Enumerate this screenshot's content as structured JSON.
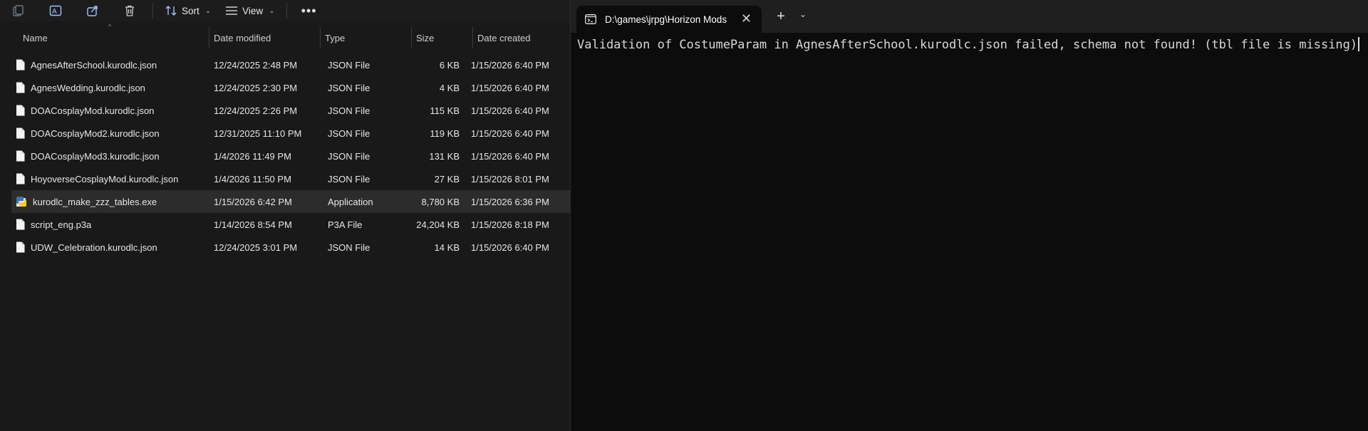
{
  "explorer": {
    "toolbar": {
      "sort_label": "Sort",
      "view_label": "View",
      "more_label": "•••",
      "icons": [
        "copy-icon",
        "rename-icon",
        "share-icon",
        "delete-icon",
        "sort-icon",
        "view-icon"
      ]
    },
    "columns": {
      "name": "Name",
      "date_modified": "Date modified",
      "type": "Type",
      "size": "Size",
      "date_created": "Date created"
    },
    "files": [
      {
        "name": "AgnesAfterSchool.kurodlc.json",
        "modified": "12/24/2025 2:48 PM",
        "type": "JSON File",
        "size": "6 KB",
        "created": "1/15/2026 6:40 PM",
        "icon": "document-icon"
      },
      {
        "name": "AgnesWedding.kurodlc.json",
        "modified": "12/24/2025 2:30 PM",
        "type": "JSON File",
        "size": "4 KB",
        "created": "1/15/2026 6:40 PM",
        "icon": "document-icon"
      },
      {
        "name": "DOACosplayMod.kurodlc.json",
        "modified": "12/24/2025 2:26 PM",
        "type": "JSON File",
        "size": "115 KB",
        "created": "1/15/2026 6:40 PM",
        "icon": "document-icon"
      },
      {
        "name": "DOACosplayMod2.kurodlc.json",
        "modified": "12/31/2025 11:10 PM",
        "type": "JSON File",
        "size": "119 KB",
        "created": "1/15/2026 6:40 PM",
        "icon": "document-icon"
      },
      {
        "name": "DOACosplayMod3.kurodlc.json",
        "modified": "1/4/2026 11:49 PM",
        "type": "JSON File",
        "size": "131 KB",
        "created": "1/15/2026 6:40 PM",
        "icon": "document-icon"
      },
      {
        "name": "HoyoverseCosplayMod.kurodlc.json",
        "modified": "1/4/2026 11:50 PM",
        "type": "JSON File",
        "size": "27 KB",
        "created": "1/15/2026 8:01 PM",
        "icon": "document-icon"
      },
      {
        "name": "kurodlc_make_zzz_tables.exe",
        "modified": "1/15/2026 6:42 PM",
        "type": "Application",
        "size": "8,780 KB",
        "created": "1/15/2026 6:36 PM",
        "icon": "python-exe-icon",
        "selected": true
      },
      {
        "name": "script_eng.p3a",
        "modified": "1/14/2026 8:54 PM",
        "type": "P3A File",
        "size": "24,204 KB",
        "created": "1/15/2026 8:18 PM",
        "icon": "document-icon"
      },
      {
        "name": "UDW_Celebration.kurodlc.json",
        "modified": "12/24/2025 3:01 PM",
        "type": "JSON File",
        "size": "14 KB",
        "created": "1/15/2026 6:40 PM",
        "icon": "document-icon"
      }
    ]
  },
  "terminal": {
    "tab_title": "D:\\games\\jrpg\\Horizon Mods",
    "tab_icon": "terminal-icon",
    "output_line": "Validation of CostumeParam in AgnesAfterSchool.kurodlc.json failed, schema not found! (tbl file is missing)"
  }
}
